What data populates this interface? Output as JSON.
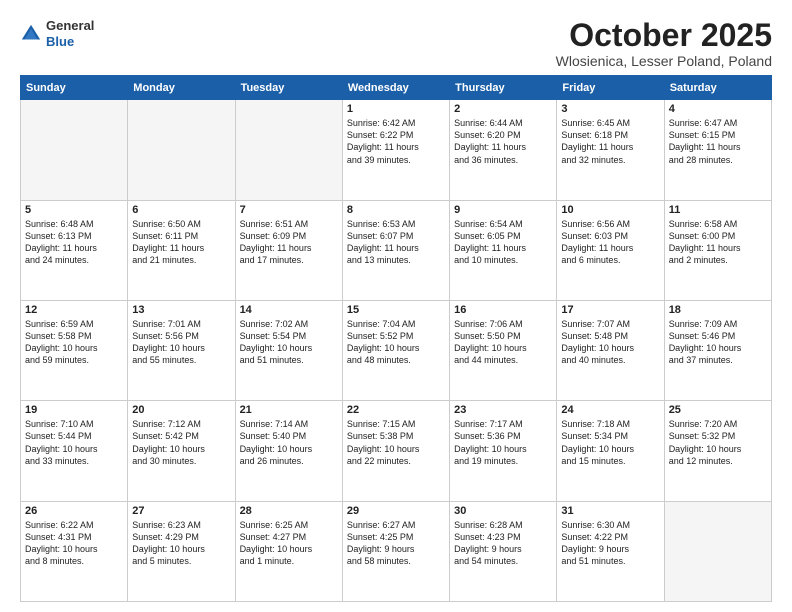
{
  "header": {
    "logo_general": "General",
    "logo_blue": "Blue",
    "month": "October 2025",
    "location": "Wlosienica, Lesser Poland, Poland"
  },
  "weekdays": [
    "Sunday",
    "Monday",
    "Tuesday",
    "Wednesday",
    "Thursday",
    "Friday",
    "Saturday"
  ],
  "weeks": [
    [
      {
        "day": "",
        "text": ""
      },
      {
        "day": "",
        "text": ""
      },
      {
        "day": "",
        "text": ""
      },
      {
        "day": "1",
        "text": "Sunrise: 6:42 AM\nSunset: 6:22 PM\nDaylight: 11 hours\nand 39 minutes."
      },
      {
        "day": "2",
        "text": "Sunrise: 6:44 AM\nSunset: 6:20 PM\nDaylight: 11 hours\nand 36 minutes."
      },
      {
        "day": "3",
        "text": "Sunrise: 6:45 AM\nSunset: 6:18 PM\nDaylight: 11 hours\nand 32 minutes."
      },
      {
        "day": "4",
        "text": "Sunrise: 6:47 AM\nSunset: 6:15 PM\nDaylight: 11 hours\nand 28 minutes."
      }
    ],
    [
      {
        "day": "5",
        "text": "Sunrise: 6:48 AM\nSunset: 6:13 PM\nDaylight: 11 hours\nand 24 minutes."
      },
      {
        "day": "6",
        "text": "Sunrise: 6:50 AM\nSunset: 6:11 PM\nDaylight: 11 hours\nand 21 minutes."
      },
      {
        "day": "7",
        "text": "Sunrise: 6:51 AM\nSunset: 6:09 PM\nDaylight: 11 hours\nand 17 minutes."
      },
      {
        "day": "8",
        "text": "Sunrise: 6:53 AM\nSunset: 6:07 PM\nDaylight: 11 hours\nand 13 minutes."
      },
      {
        "day": "9",
        "text": "Sunrise: 6:54 AM\nSunset: 6:05 PM\nDaylight: 11 hours\nand 10 minutes."
      },
      {
        "day": "10",
        "text": "Sunrise: 6:56 AM\nSunset: 6:03 PM\nDaylight: 11 hours\nand 6 minutes."
      },
      {
        "day": "11",
        "text": "Sunrise: 6:58 AM\nSunset: 6:00 PM\nDaylight: 11 hours\nand 2 minutes."
      }
    ],
    [
      {
        "day": "12",
        "text": "Sunrise: 6:59 AM\nSunset: 5:58 PM\nDaylight: 10 hours\nand 59 minutes."
      },
      {
        "day": "13",
        "text": "Sunrise: 7:01 AM\nSunset: 5:56 PM\nDaylight: 10 hours\nand 55 minutes."
      },
      {
        "day": "14",
        "text": "Sunrise: 7:02 AM\nSunset: 5:54 PM\nDaylight: 10 hours\nand 51 minutes."
      },
      {
        "day": "15",
        "text": "Sunrise: 7:04 AM\nSunset: 5:52 PM\nDaylight: 10 hours\nand 48 minutes."
      },
      {
        "day": "16",
        "text": "Sunrise: 7:06 AM\nSunset: 5:50 PM\nDaylight: 10 hours\nand 44 minutes."
      },
      {
        "day": "17",
        "text": "Sunrise: 7:07 AM\nSunset: 5:48 PM\nDaylight: 10 hours\nand 40 minutes."
      },
      {
        "day": "18",
        "text": "Sunrise: 7:09 AM\nSunset: 5:46 PM\nDaylight: 10 hours\nand 37 minutes."
      }
    ],
    [
      {
        "day": "19",
        "text": "Sunrise: 7:10 AM\nSunset: 5:44 PM\nDaylight: 10 hours\nand 33 minutes."
      },
      {
        "day": "20",
        "text": "Sunrise: 7:12 AM\nSunset: 5:42 PM\nDaylight: 10 hours\nand 30 minutes."
      },
      {
        "day": "21",
        "text": "Sunrise: 7:14 AM\nSunset: 5:40 PM\nDaylight: 10 hours\nand 26 minutes."
      },
      {
        "day": "22",
        "text": "Sunrise: 7:15 AM\nSunset: 5:38 PM\nDaylight: 10 hours\nand 22 minutes."
      },
      {
        "day": "23",
        "text": "Sunrise: 7:17 AM\nSunset: 5:36 PM\nDaylight: 10 hours\nand 19 minutes."
      },
      {
        "day": "24",
        "text": "Sunrise: 7:18 AM\nSunset: 5:34 PM\nDaylight: 10 hours\nand 15 minutes."
      },
      {
        "day": "25",
        "text": "Sunrise: 7:20 AM\nSunset: 5:32 PM\nDaylight: 10 hours\nand 12 minutes."
      }
    ],
    [
      {
        "day": "26",
        "text": "Sunrise: 6:22 AM\nSunset: 4:31 PM\nDaylight: 10 hours\nand 8 minutes."
      },
      {
        "day": "27",
        "text": "Sunrise: 6:23 AM\nSunset: 4:29 PM\nDaylight: 10 hours\nand 5 minutes."
      },
      {
        "day": "28",
        "text": "Sunrise: 6:25 AM\nSunset: 4:27 PM\nDaylight: 10 hours\nand 1 minute."
      },
      {
        "day": "29",
        "text": "Sunrise: 6:27 AM\nSunset: 4:25 PM\nDaylight: 9 hours\nand 58 minutes."
      },
      {
        "day": "30",
        "text": "Sunrise: 6:28 AM\nSunset: 4:23 PM\nDaylight: 9 hours\nand 54 minutes."
      },
      {
        "day": "31",
        "text": "Sunrise: 6:30 AM\nSunset: 4:22 PM\nDaylight: 9 hours\nand 51 minutes."
      },
      {
        "day": "",
        "text": ""
      }
    ]
  ]
}
